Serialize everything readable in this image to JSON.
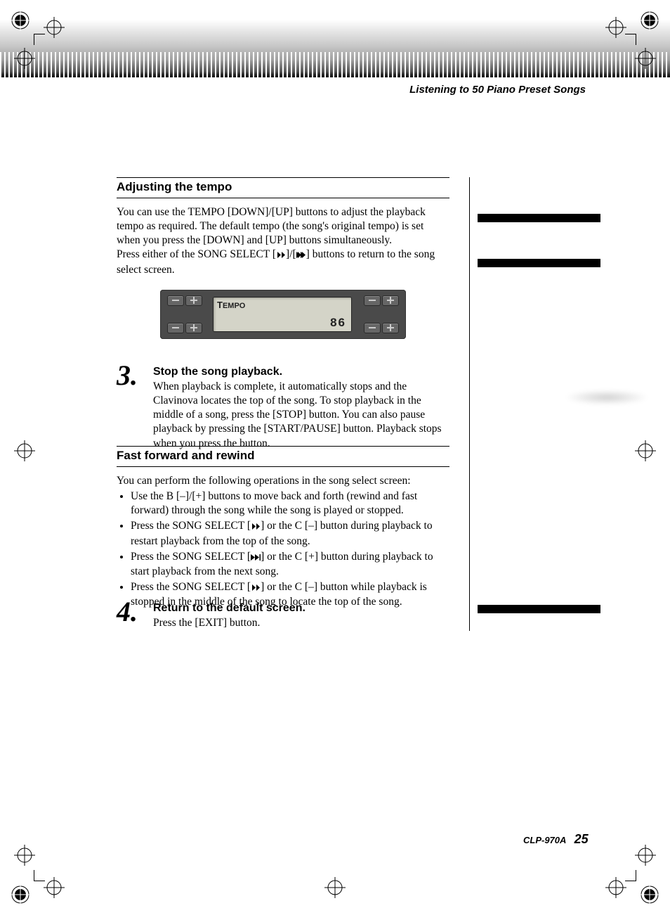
{
  "breadcrumb": "Listening to 50 Piano Preset Songs",
  "sections": {
    "tempo": {
      "heading": "Adjusting the tempo",
      "p1a": "You can use the TEMPO [DOWN]/[UP] buttons to adjust the playback tempo as required. The default tempo (the song's original tempo) is set when you press the [DOWN] and [UP] buttons simultaneously.",
      "p1b_a": "Press either of the SONG SELECT [",
      "p1b_b": "]/[",
      "p1b_c": "] buttons to return to the song select screen."
    },
    "ffrw": {
      "heading": "Fast forward and rewind",
      "intro": "You can perform the following operations in the song select screen:",
      "b1": "Use the B [–]/[+] buttons to move back and forth (rewind and fast forward) through the song while the song is played or stopped.",
      "b2a": "Press the SONG SELECT [",
      "b2b": "] or the C [–] button during playback to restart playback from the top of the song.",
      "b3a": "Press the SONG SELECT [",
      "b3b": "] or the C [+] button during playback to start playback from the next song.",
      "b4a": "Press the SONG SELECT [",
      "b4b": "] or the C [–] button while playback is stopped in the middle of the song to locate the top of the song."
    }
  },
  "steps": {
    "s3": {
      "num": "3.",
      "heading": "Stop the song playback.",
      "text": "When playback is complete, it automatically stops and the Clavinova locates the top of the song. To stop playback in the middle of a song, press the [STOP] button. You can also pause playback by pressing the [START/PAUSE] button. Playback stops when you press the button."
    },
    "s4": {
      "num": "4.",
      "heading": "Return to the default screen.",
      "text": "Press the [EXIT] button."
    }
  },
  "lcd": {
    "label": "TEMPO",
    "value": "86"
  },
  "footer": {
    "model": "CLP-970A",
    "page": "25"
  }
}
